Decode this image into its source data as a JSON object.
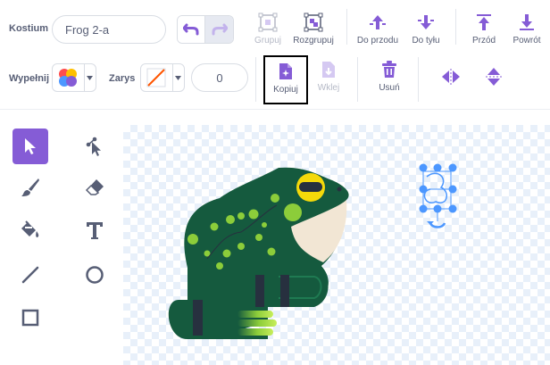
{
  "costume": {
    "label": "Kostium",
    "name": "Frog 2-a"
  },
  "toolbar1": {
    "group": "Grupuj",
    "ungroup": "Rozgrupuj",
    "forward": "Do przodu",
    "backward": "Do tyłu",
    "front": "Przód",
    "back": "Powrót"
  },
  "toolbar2": {
    "fill_label": "Wypełnij",
    "outline_label": "Zarys",
    "outline_width": "0",
    "copy": "Kopiuj",
    "paste": "Wklej",
    "delete": "Usuń"
  },
  "colors": {
    "accent": "#855cd6",
    "disabled": "#b5b9c6",
    "selection": "#4c97ff",
    "delete": "#855cd6"
  }
}
